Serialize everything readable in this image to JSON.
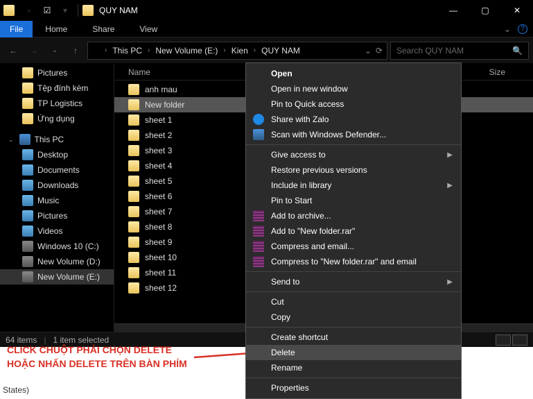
{
  "window": {
    "title": "QUY NAM",
    "tabs": {
      "file": "File",
      "home": "Home",
      "share": "Share",
      "view": "View"
    }
  },
  "breadcrumb": {
    "seg1": "This PC",
    "seg2": "New Volume (E:)",
    "seg3": "Kien",
    "seg4": "QUY NAM"
  },
  "search": {
    "placeholder": "Search QUY NAM"
  },
  "sidebar": {
    "items": [
      {
        "label": "Pictures"
      },
      {
        "label": "Tệp đính kèm"
      },
      {
        "label": "TP Logistics"
      },
      {
        "label": "Ứng dụng"
      }
    ],
    "section_pc": "This PC",
    "pc_items": [
      {
        "label": "Desktop"
      },
      {
        "label": "Documents"
      },
      {
        "label": "Downloads"
      },
      {
        "label": "Music"
      },
      {
        "label": "Pictures"
      },
      {
        "label": "Videos"
      },
      {
        "label": "Windows 10 (C:)"
      },
      {
        "label": "New Volume (D:)"
      },
      {
        "label": "New Volume (E:)"
      }
    ]
  },
  "columns": {
    "name": "Name",
    "size": "Size"
  },
  "files": {
    "rows": [
      {
        "name": "anh mau"
      },
      {
        "name": "New folder"
      },
      {
        "name": "sheet 1"
      },
      {
        "name": "sheet 2"
      },
      {
        "name": "sheet 3"
      },
      {
        "name": "sheet 4"
      },
      {
        "name": "sheet 5"
      },
      {
        "name": "sheet 6"
      },
      {
        "name": "sheet 7"
      },
      {
        "name": "sheet 8"
      },
      {
        "name": "sheet 9"
      },
      {
        "name": "sheet 10"
      },
      {
        "name": "sheet 11"
      },
      {
        "name": "sheet 12"
      }
    ]
  },
  "status": {
    "items": "64 items",
    "selected": "1 item selected"
  },
  "context": {
    "open": "Open",
    "open_new": "Open in new window",
    "pin_quick": "Pin to Quick access",
    "zalo": "Share with Zalo",
    "defender": "Scan with Windows Defender...",
    "give_access": "Give access to",
    "restore": "Restore previous versions",
    "include_lib": "Include in library",
    "pin_start": "Pin to Start",
    "add_archive": "Add to archive...",
    "add_rar": "Add to \"New folder.rar\"",
    "compress_email": "Compress and email...",
    "compress_rar_email": "Compress to \"New folder.rar\" and email",
    "send_to": "Send to",
    "cut": "Cut",
    "copy": "Copy",
    "create_shortcut": "Create shortcut",
    "delete": "Delete",
    "rename": "Rename",
    "properties": "Properties"
  },
  "annotation": {
    "line1": "CLICK CHUỘT PHẢI CHỌN DELETE",
    "line2": "HOẶC NHẤN DELETE TRÊN BÀN PHÍM"
  },
  "footer_lane": "States)"
}
